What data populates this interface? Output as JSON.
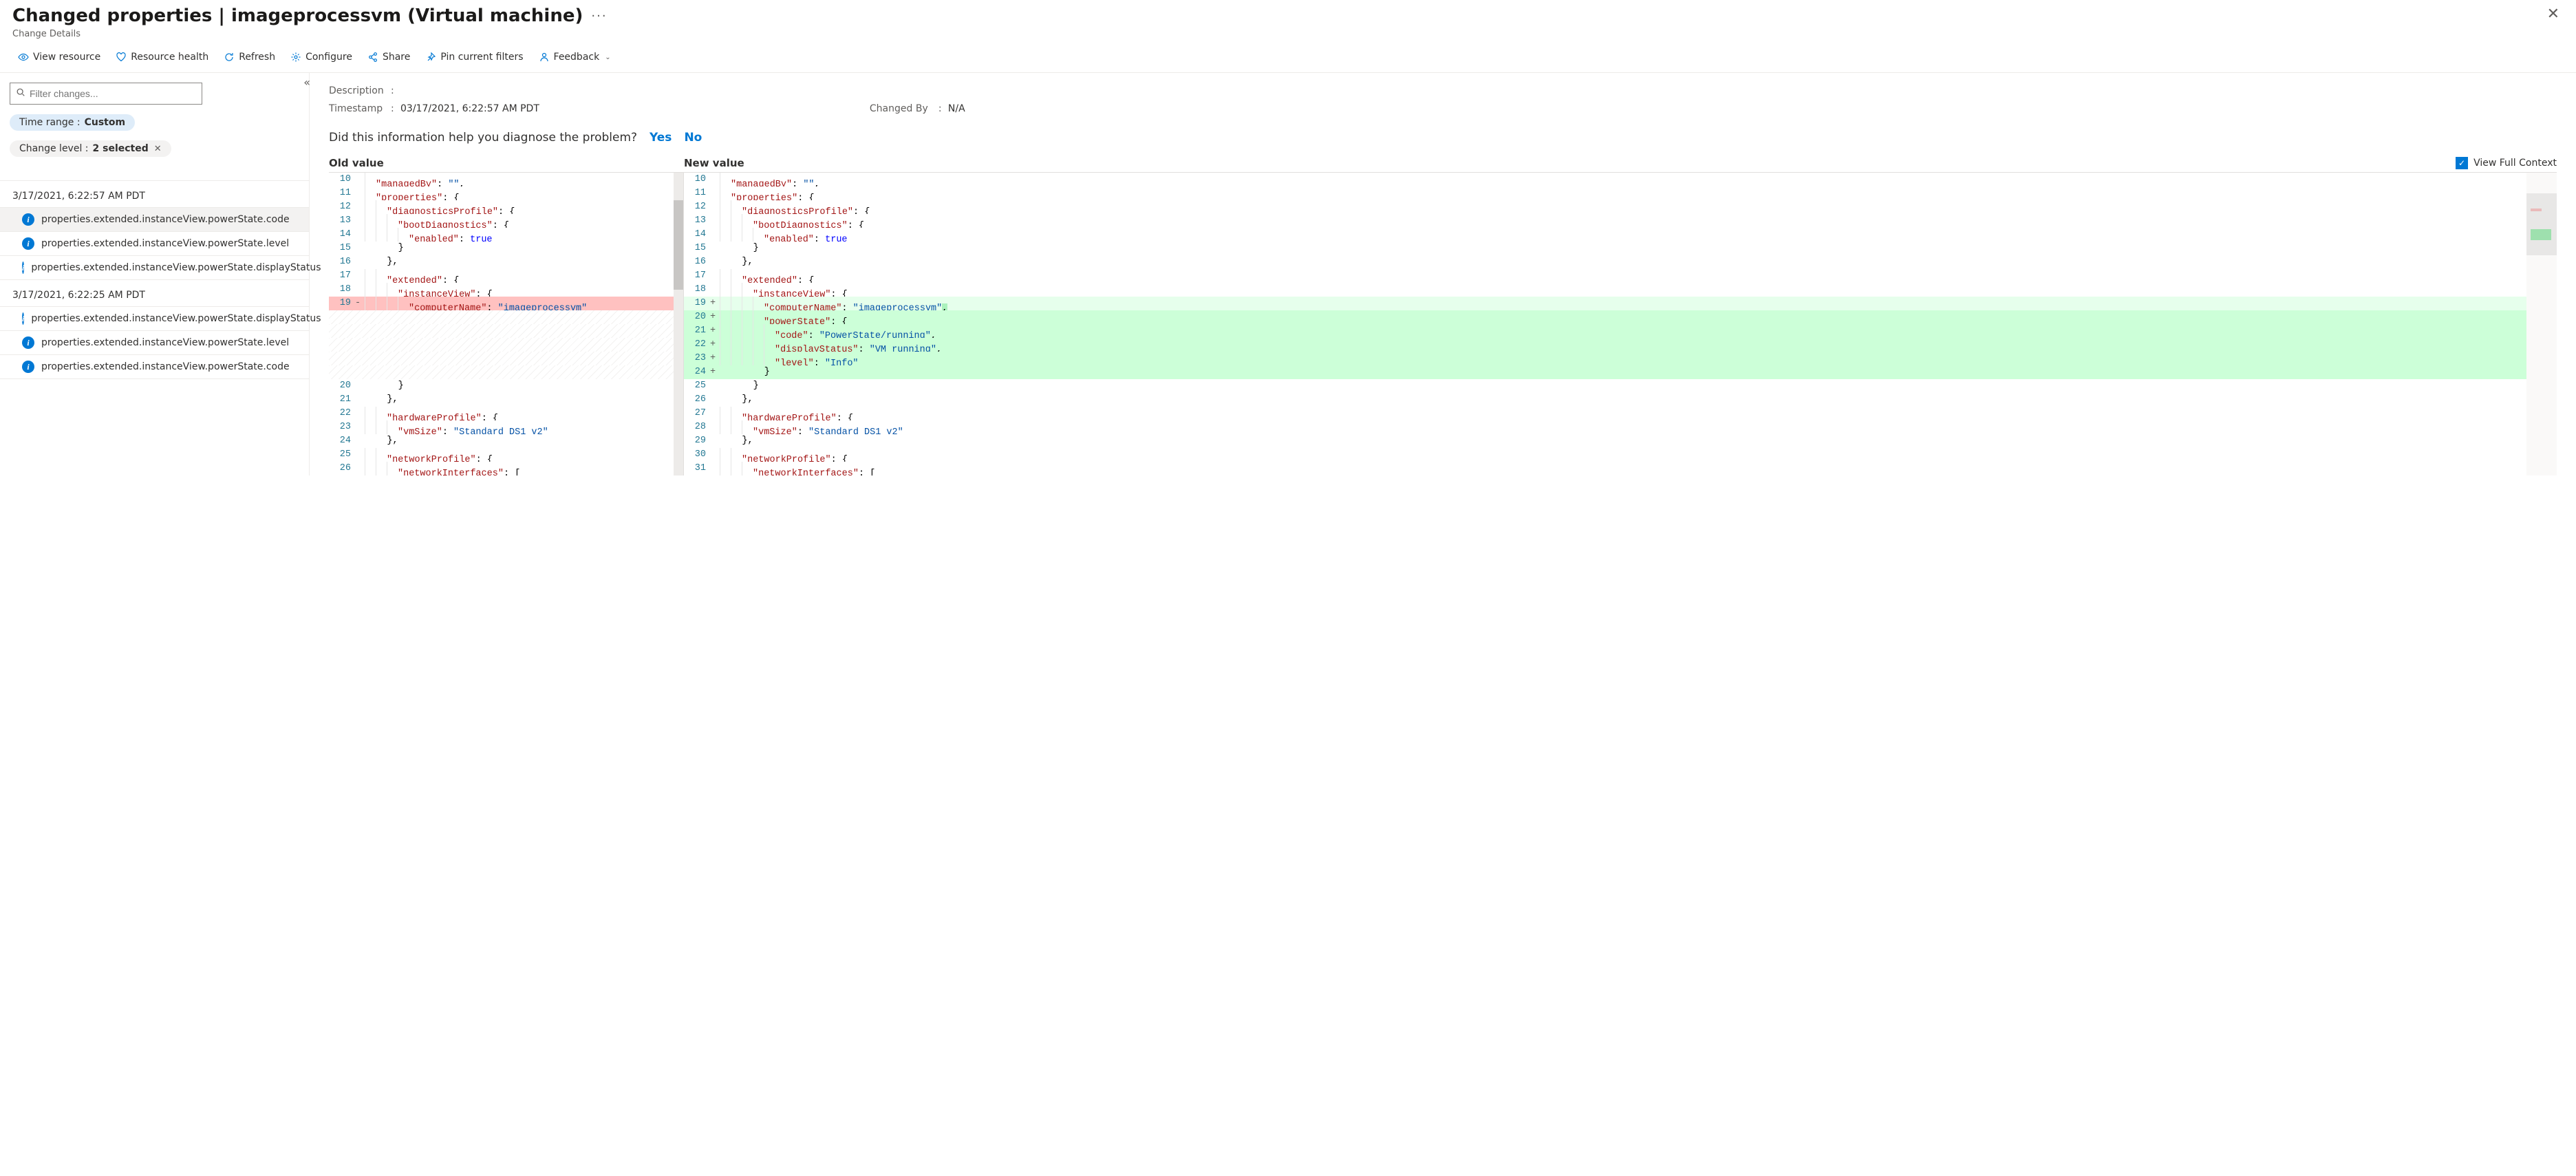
{
  "header": {
    "title": "Changed properties | imageprocessvm (Virtual machine)",
    "subtitle": "Change Details"
  },
  "toolbar": {
    "view_resource": "View resource",
    "resource_health": "Resource health",
    "refresh": "Refresh",
    "configure": "Configure",
    "share": "Share",
    "pin": "Pin current filters",
    "feedback": "Feedback"
  },
  "sidebar": {
    "filter_placeholder": "Filter changes...",
    "pill_time_label": "Time range : ",
    "pill_time_value": "Custom",
    "pill_level_label": "Change level : ",
    "pill_level_value": "2 selected",
    "groups": [
      {
        "time": "3/17/2021, 6:22:57 AM PDT",
        "rows": [
          {
            "path": "properties.extended.instanceView.powerState.code",
            "selected": true
          },
          {
            "path": "properties.extended.instanceView.powerState.level",
            "selected": false
          },
          {
            "path": "properties.extended.instanceView.powerState.displayStatus",
            "selected": false
          }
        ]
      },
      {
        "time": "3/17/2021, 6:22:25 AM PDT",
        "rows": [
          {
            "path": "properties.extended.instanceView.powerState.displayStatus",
            "selected": false
          },
          {
            "path": "properties.extended.instanceView.powerState.level",
            "selected": false
          },
          {
            "path": "properties.extended.instanceView.powerState.code",
            "selected": false
          }
        ]
      }
    ]
  },
  "meta": {
    "desc_label": "Description",
    "desc_value": "",
    "ts_label": "Timestamp",
    "ts_value": "03/17/2021, 6:22:57 AM PDT",
    "by_label": "Changed By",
    "by_value": "N/A"
  },
  "question": {
    "text": "Did this information help you diagnose the problem?",
    "yes": "Yes",
    "no": "No"
  },
  "diff": {
    "old_label": "Old value",
    "new_label": "New value",
    "full_ctx": "View Full Context",
    "old_lines": [
      {
        "n": 10,
        "m": "",
        "seg": [
          {
            "t": "  ",
            "c": ""
          },
          {
            "t": "\"managedBy\"",
            "c": "kw-key"
          },
          {
            "t": ": ",
            "c": "kw-punc"
          },
          {
            "t": "\"\"",
            "c": "kw-str"
          },
          {
            "t": ",",
            "c": "kw-punc"
          }
        ]
      },
      {
        "n": 11,
        "m": "",
        "seg": [
          {
            "t": "  ",
            "c": ""
          },
          {
            "t": "\"properties\"",
            "c": "kw-key"
          },
          {
            "t": ": {",
            "c": "kw-punc"
          }
        ]
      },
      {
        "n": 12,
        "m": "",
        "seg": [
          {
            "t": "    ",
            "c": ""
          },
          {
            "t": "\"diagnosticsProfile\"",
            "c": "kw-key"
          },
          {
            "t": ": {",
            "c": "kw-punc"
          }
        ]
      },
      {
        "n": 13,
        "m": "",
        "seg": [
          {
            "t": "      ",
            "c": ""
          },
          {
            "t": "\"bootDiagnostics\"",
            "c": "kw-key"
          },
          {
            "t": ": {",
            "c": "kw-punc"
          }
        ]
      },
      {
        "n": 14,
        "m": "",
        "seg": [
          {
            "t": "        ",
            "c": ""
          },
          {
            "t": "\"enabled\"",
            "c": "kw-key"
          },
          {
            "t": ": ",
            "c": "kw-punc"
          },
          {
            "t": "true",
            "c": "kw-bool"
          }
        ]
      },
      {
        "n": 15,
        "m": "",
        "seg": [
          {
            "t": "      }",
            "c": "kw-punc"
          }
        ]
      },
      {
        "n": 16,
        "m": "",
        "seg": [
          {
            "t": "    },",
            "c": "kw-punc"
          }
        ]
      },
      {
        "n": 17,
        "m": "",
        "seg": [
          {
            "t": "    ",
            "c": ""
          },
          {
            "t": "\"extended\"",
            "c": "kw-key"
          },
          {
            "t": ": {",
            "c": "kw-punc"
          }
        ]
      },
      {
        "n": 18,
        "m": "",
        "seg": [
          {
            "t": "      ",
            "c": ""
          },
          {
            "t": "\"instanceView\"",
            "c": "kw-key"
          },
          {
            "t": ": {",
            "c": "kw-punc"
          }
        ]
      },
      {
        "n": 19,
        "m": "-",
        "cls": "line-del strong",
        "seg": [
          {
            "t": "        ",
            "c": ""
          },
          {
            "t": "\"computerName\"",
            "c": "kw-key"
          },
          {
            "t": ": ",
            "c": "kw-punc"
          },
          {
            "t": "\"imageprocessvm\"",
            "c": "kw-str"
          }
        ]
      },
      {
        "n": "",
        "m": "",
        "cls": "hatched",
        "seg": []
      },
      {
        "n": "",
        "m": "",
        "cls": "hatched",
        "seg": []
      },
      {
        "n": "",
        "m": "",
        "cls": "hatched",
        "seg": []
      },
      {
        "n": "",
        "m": "",
        "cls": "hatched",
        "seg": []
      },
      {
        "n": "",
        "m": "",
        "cls": "hatched",
        "seg": []
      },
      {
        "n": 20,
        "m": "",
        "seg": [
          {
            "t": "      }",
            "c": "kw-punc"
          }
        ]
      },
      {
        "n": 21,
        "m": "",
        "seg": [
          {
            "t": "    },",
            "c": "kw-punc"
          }
        ]
      },
      {
        "n": 22,
        "m": "",
        "seg": [
          {
            "t": "    ",
            "c": ""
          },
          {
            "t": "\"hardwareProfile\"",
            "c": "kw-key"
          },
          {
            "t": ": {",
            "c": "kw-punc"
          }
        ]
      },
      {
        "n": 23,
        "m": "",
        "seg": [
          {
            "t": "      ",
            "c": ""
          },
          {
            "t": "\"vmSize\"",
            "c": "kw-key"
          },
          {
            "t": ": ",
            "c": "kw-punc"
          },
          {
            "t": "\"Standard_DS1_v2\"",
            "c": "kw-str"
          }
        ]
      },
      {
        "n": 24,
        "m": "",
        "seg": [
          {
            "t": "    },",
            "c": "kw-punc"
          }
        ]
      },
      {
        "n": 25,
        "m": "",
        "seg": [
          {
            "t": "    ",
            "c": ""
          },
          {
            "t": "\"networkProfile\"",
            "c": "kw-key"
          },
          {
            "t": ": {",
            "c": "kw-punc"
          }
        ]
      },
      {
        "n": 26,
        "m": "",
        "seg": [
          {
            "t": "      ",
            "c": ""
          },
          {
            "t": "\"networkInterfaces\"",
            "c": "kw-key"
          },
          {
            "t": ": [",
            "c": "kw-punc"
          }
        ]
      }
    ],
    "new_lines": [
      {
        "n": 10,
        "m": "",
        "seg": [
          {
            "t": "  ",
            "c": ""
          },
          {
            "t": "\"managedBy\"",
            "c": "kw-key"
          },
          {
            "t": ": ",
            "c": "kw-punc"
          },
          {
            "t": "\"\"",
            "c": "kw-str"
          },
          {
            "t": ",",
            "c": "kw-punc"
          }
        ]
      },
      {
        "n": 11,
        "m": "",
        "seg": [
          {
            "t": "  ",
            "c": ""
          },
          {
            "t": "\"properties\"",
            "c": "kw-key"
          },
          {
            "t": ": {",
            "c": "kw-punc"
          }
        ]
      },
      {
        "n": 12,
        "m": "",
        "seg": [
          {
            "t": "    ",
            "c": ""
          },
          {
            "t": "\"diagnosticsProfile\"",
            "c": "kw-key"
          },
          {
            "t": ": {",
            "c": "kw-punc"
          }
        ]
      },
      {
        "n": 13,
        "m": "",
        "seg": [
          {
            "t": "      ",
            "c": ""
          },
          {
            "t": "\"bootDiagnostics\"",
            "c": "kw-key"
          },
          {
            "t": ": {",
            "c": "kw-punc"
          }
        ]
      },
      {
        "n": 14,
        "m": "",
        "seg": [
          {
            "t": "        ",
            "c": ""
          },
          {
            "t": "\"enabled\"",
            "c": "kw-key"
          },
          {
            "t": ": ",
            "c": "kw-punc"
          },
          {
            "t": "true",
            "c": "kw-bool"
          }
        ]
      },
      {
        "n": 15,
        "m": "",
        "seg": [
          {
            "t": "      }",
            "c": "kw-punc"
          }
        ]
      },
      {
        "n": 16,
        "m": "",
        "seg": [
          {
            "t": "    },",
            "c": "kw-punc"
          }
        ]
      },
      {
        "n": 17,
        "m": "",
        "seg": [
          {
            "t": "    ",
            "c": ""
          },
          {
            "t": "\"extended\"",
            "c": "kw-key"
          },
          {
            "t": ": {",
            "c": "kw-punc"
          }
        ]
      },
      {
        "n": 18,
        "m": "",
        "seg": [
          {
            "t": "      ",
            "c": ""
          },
          {
            "t": "\"instanceView\"",
            "c": "kw-key"
          },
          {
            "t": ": {",
            "c": "kw-punc"
          }
        ]
      },
      {
        "n": 19,
        "m": "+",
        "cls": "line-add",
        "seg": [
          {
            "t": "        ",
            "c": ""
          },
          {
            "t": "\"computerName\"",
            "c": "kw-key"
          },
          {
            "t": ": ",
            "c": "kw-punc"
          },
          {
            "t": "\"imageprocessvm\"",
            "c": "kw-str"
          },
          {
            "t": ",",
            "c": "kw-punc token-add"
          }
        ]
      },
      {
        "n": 20,
        "m": "+",
        "cls": "line-add strong",
        "seg": [
          {
            "t": "        ",
            "c": ""
          },
          {
            "t": "\"powerState\"",
            "c": "kw-key"
          },
          {
            "t": ": {",
            "c": "kw-punc"
          }
        ]
      },
      {
        "n": 21,
        "m": "+",
        "cls": "line-add strong",
        "seg": [
          {
            "t": "          ",
            "c": ""
          },
          {
            "t": "\"code\"",
            "c": "kw-key"
          },
          {
            "t": ": ",
            "c": "kw-punc"
          },
          {
            "t": "\"PowerState/running\"",
            "c": "kw-str"
          },
          {
            "t": ",",
            "c": "kw-punc"
          }
        ]
      },
      {
        "n": 22,
        "m": "+",
        "cls": "line-add strong",
        "seg": [
          {
            "t": "          ",
            "c": ""
          },
          {
            "t": "\"displayStatus\"",
            "c": "kw-key"
          },
          {
            "t": ": ",
            "c": "kw-punc"
          },
          {
            "t": "\"VM running\"",
            "c": "kw-str"
          },
          {
            "t": ",",
            "c": "kw-punc"
          }
        ]
      },
      {
        "n": 23,
        "m": "+",
        "cls": "line-add strong",
        "seg": [
          {
            "t": "          ",
            "c": ""
          },
          {
            "t": "\"level\"",
            "c": "kw-key"
          },
          {
            "t": ": ",
            "c": "kw-punc"
          },
          {
            "t": "\"Info\"",
            "c": "kw-str"
          }
        ]
      },
      {
        "n": 24,
        "m": "+",
        "cls": "line-add strong",
        "seg": [
          {
            "t": "        }",
            "c": "kw-punc"
          }
        ]
      },
      {
        "n": 25,
        "m": "",
        "seg": [
          {
            "t": "      }",
            "c": "kw-punc"
          }
        ]
      },
      {
        "n": 26,
        "m": "",
        "seg": [
          {
            "t": "    },",
            "c": "kw-punc"
          }
        ]
      },
      {
        "n": 27,
        "m": "",
        "seg": [
          {
            "t": "    ",
            "c": ""
          },
          {
            "t": "\"hardwareProfile\"",
            "c": "kw-key"
          },
          {
            "t": ": {",
            "c": "kw-punc"
          }
        ]
      },
      {
        "n": 28,
        "m": "",
        "seg": [
          {
            "t": "      ",
            "c": ""
          },
          {
            "t": "\"vmSize\"",
            "c": "kw-key"
          },
          {
            "t": ": ",
            "c": "kw-punc"
          },
          {
            "t": "\"Standard_DS1_v2\"",
            "c": "kw-str"
          }
        ]
      },
      {
        "n": 29,
        "m": "",
        "seg": [
          {
            "t": "    },",
            "c": "kw-punc"
          }
        ]
      },
      {
        "n": 30,
        "m": "",
        "seg": [
          {
            "t": "    ",
            "c": ""
          },
          {
            "t": "\"networkProfile\"",
            "c": "kw-key"
          },
          {
            "t": ": {",
            "c": "kw-punc"
          }
        ]
      },
      {
        "n": 31,
        "m": "",
        "seg": [
          {
            "t": "      ",
            "c": ""
          },
          {
            "t": "\"networkInterfaces\"",
            "c": "kw-key"
          },
          {
            "t": ": [",
            "c": "kw-punc"
          }
        ]
      }
    ]
  }
}
